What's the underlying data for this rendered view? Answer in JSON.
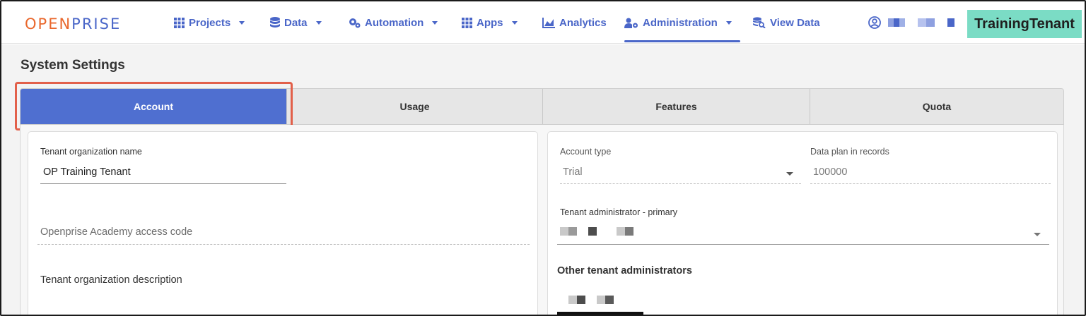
{
  "brand": {
    "logo_part1": "OPEN",
    "logo_part2": "PRISE",
    "tenant_badge": "TrainingTenant"
  },
  "nav": {
    "items": [
      {
        "label": "Projects",
        "icon": "grid-icon",
        "dropdown": true
      },
      {
        "label": "Data",
        "icon": "database-icon",
        "dropdown": true
      },
      {
        "label": "Automation",
        "icon": "cogs-icon",
        "dropdown": true
      },
      {
        "label": "Apps",
        "icon": "grid-icon",
        "dropdown": true
      },
      {
        "label": "Analytics",
        "icon": "chart-area-icon",
        "dropdown": false
      },
      {
        "label": "Administration",
        "icon": "user-cog-icon",
        "dropdown": true,
        "active": true
      },
      {
        "label": "View Data",
        "icon": "data-search-icon",
        "dropdown": false
      }
    ],
    "user_icon": "user-circle-icon"
  },
  "page": {
    "title": "System Settings",
    "tabs": [
      {
        "label": "Account",
        "active": true
      },
      {
        "label": "Usage"
      },
      {
        "label": "Features"
      },
      {
        "label": "Quota"
      }
    ]
  },
  "account": {
    "org_name_label": "Tenant organization name",
    "org_name_value": "OP Training Tenant",
    "academy_code_placeholder": "Openprise Academy access code",
    "org_description_label": "Tenant organization description",
    "account_type_label": "Account type",
    "account_type_value": "Trial",
    "data_plan_label": "Data plan in records",
    "data_plan_value": "100000",
    "primary_admin_label": "Tenant administrator - primary",
    "other_admins_heading": "Other tenant administrators"
  },
  "colors": {
    "accent": "#4f6fd0",
    "brand_orange": "#e9672c",
    "highlight": "#e2604a",
    "tenant_badge_bg": "#7bdcc5"
  }
}
